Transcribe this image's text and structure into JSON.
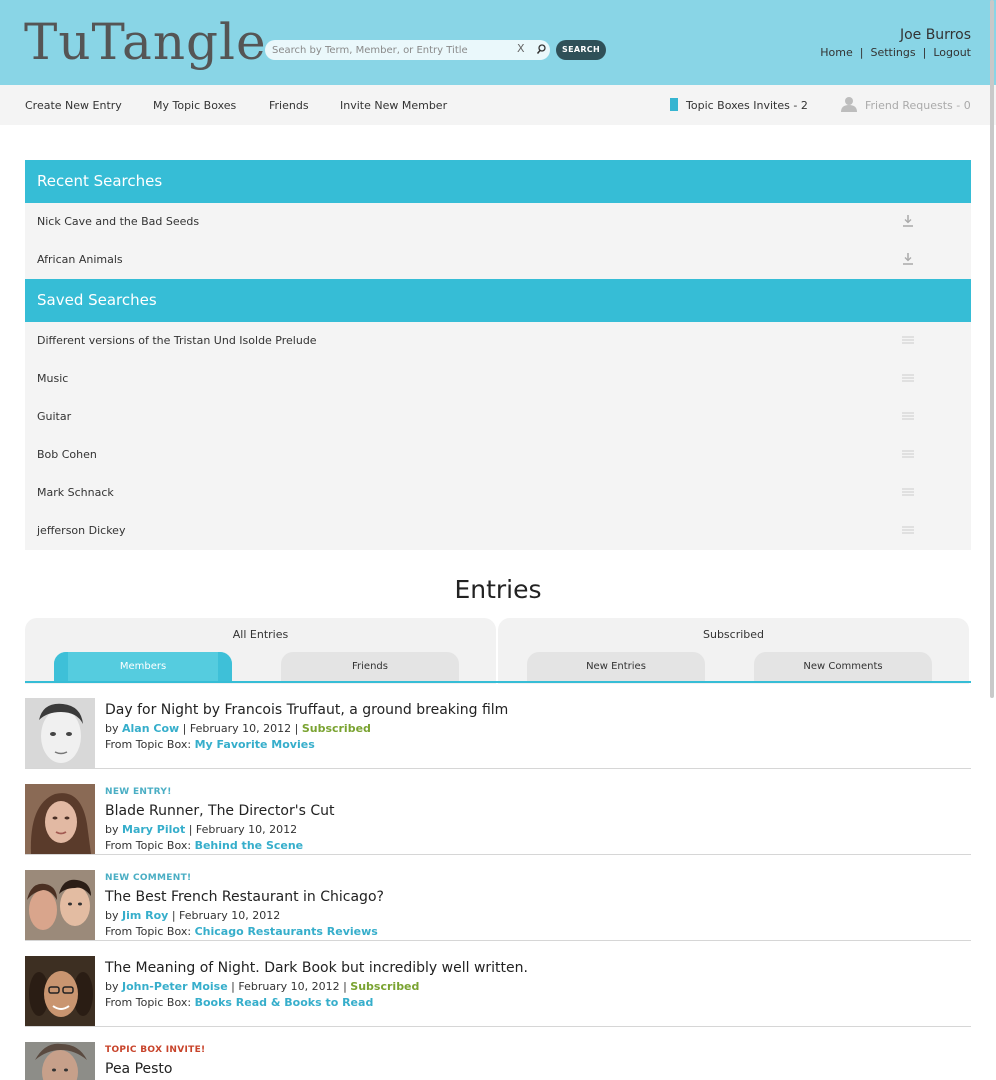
{
  "header": {
    "logo": "TuTangle",
    "search_placeholder": "Search by Term, Member, or Entry Title",
    "search_clear": "X",
    "search_button": "SEARCH",
    "username": "Joe Burros",
    "links": [
      "Home",
      "Settings",
      "Logout"
    ],
    "separator": "|"
  },
  "nav": {
    "items": [
      "Create New Entry",
      "My Topic Boxes",
      "Friends",
      "Invite New Member"
    ],
    "topic_box_invites": "Topic Boxes Invites - 2",
    "friend_requests": "Friend Requests - 0"
  },
  "recent_searches": {
    "title": "Recent Searches",
    "items": [
      "Nick Cave and the Bad Seeds",
      "African Animals"
    ]
  },
  "saved_searches": {
    "title": "Saved Searches",
    "items": [
      "Different versions of the Tristan Und Isolde Prelude",
      "Music",
      "Guitar",
      "Bob Cohen",
      "Mark Schnack",
      "jefferson Dickey"
    ]
  },
  "entries": {
    "title": "Entries",
    "groups": [
      {
        "label": "All Entries",
        "tabs": [
          "Members",
          "Friends"
        ]
      },
      {
        "label": "Subscribed",
        "tabs": [
          "New Entries",
          "New Comments"
        ]
      }
    ],
    "active_tab": "Members",
    "list": [
      {
        "tag": "",
        "title": "Day for Night by Francois Truffaut, a ground breaking film",
        "by": "by",
        "author": "Alan Cow",
        "date": "| February 10, 2012 |",
        "subscribed": "Subscribed",
        "from_label": "From Topic Box:",
        "topic_box": "My Favorite Movies"
      },
      {
        "tag": "NEW ENTRY!",
        "title": "Blade Runner, The Director's Cut",
        "by": "by",
        "author": "Mary Pilot",
        "date": "| February 10, 2012",
        "subscribed": "",
        "from_label": "From Topic Box:",
        "topic_box": "Behind the Scene"
      },
      {
        "tag": "NEW COMMENT!",
        "title": "The Best French Restaurant in Chicago?",
        "by": "by",
        "author": "Jim Roy",
        "date": "| February 10, 2012",
        "subscribed": "",
        "from_label": "From Topic Box:",
        "topic_box": "Chicago Restaurants Reviews"
      },
      {
        "tag": "",
        "title": "The Meaning of Night. Dark Book but incredibly well written.",
        "by": "by",
        "author": "John-Peter Moise",
        "date": "| February 10, 2012 |",
        "subscribed": "Subscribed",
        "from_label": "From Topic Box:",
        "topic_box": "Books Read & Books to Read"
      },
      {
        "tag": "TOPIC BOX INVITE!",
        "title": "Pea Pesto"
      }
    ]
  },
  "colors": {
    "header_bg": "#89d5e6",
    "accent": "#36bdd6",
    "link": "#36aecb",
    "subscribed": "#7aa331",
    "invite_tag": "#c8432a"
  }
}
